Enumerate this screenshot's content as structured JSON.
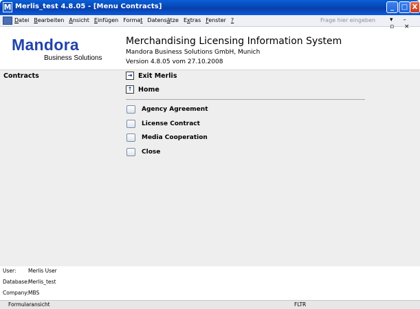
{
  "window": {
    "app_icon_letter": "M",
    "title": "Merlis_test 4.8.05 - [Menu Contracts]",
    "min_label": "_",
    "max_label": "□",
    "close_label": "X"
  },
  "menubar": {
    "items": [
      {
        "acc": "D",
        "rest": "atei"
      },
      {
        "acc": "B",
        "rest": "earbeiten"
      },
      {
        "acc": "A",
        "rest": "nsicht"
      },
      {
        "acc": "E",
        "rest": "infügen"
      },
      {
        "pre": "Forma",
        "acc": "t",
        "rest": ""
      },
      {
        "pre": "Datens",
        "acc": "ä",
        "rest": "tze"
      },
      {
        "pre": "E",
        "acc": "x",
        "rest": "tras"
      },
      {
        "acc": "F",
        "rest": "enster"
      },
      {
        "acc": "?",
        "rest": ""
      }
    ],
    "help_placeholder": "Frage hier eingeben",
    "controls": "▾ – ▫ ×"
  },
  "header": {
    "brand": "Mandora",
    "brand_sub": "Business Solutions",
    "system_title": "Merchandising Licensing Information System",
    "company": "Mandora Business Solutions GmbH, Munich",
    "version": "Version 4.8.05 vom 27.10.2008"
  },
  "left": {
    "section_title": "Contracts"
  },
  "nav": {
    "exit_label": "Exit Merlis",
    "exit_icon": "⇥",
    "home_label": "Home",
    "home_icon": "↑"
  },
  "options": [
    "Agency Agreement",
    "License Contract",
    "Media Cooperation",
    "Close"
  ],
  "info": {
    "user_key": "User:",
    "user_val": "Merlis User",
    "db_key": "Database:",
    "db_val": "Merlis_test",
    "company_key": "Company:",
    "company_val": "MBS"
  },
  "status": {
    "left": "Formularansicht",
    "right": "FLTR"
  }
}
